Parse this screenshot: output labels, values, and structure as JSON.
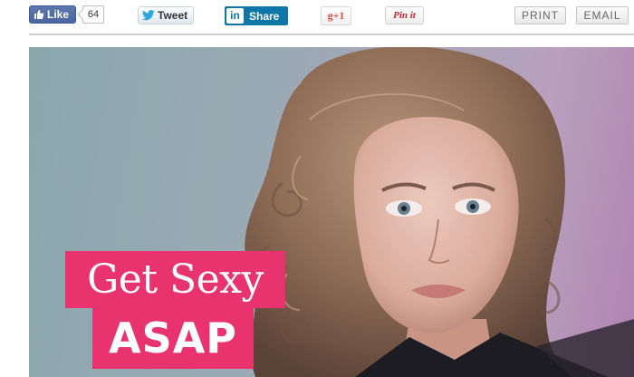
{
  "share_bar": {
    "facebook": {
      "label": "Like",
      "count": "64"
    },
    "twitter": {
      "label": "Tweet"
    },
    "linkedin": {
      "logo": "in",
      "label": "Share"
    },
    "google_plus": {
      "label": "g+1"
    },
    "pinterest": {
      "label": "Pin it"
    },
    "print": {
      "label": "PRINT"
    },
    "email": {
      "label": "EMAIL"
    }
  },
  "hero": {
    "headline_line1": "Get Sexy",
    "headline_line2": "ASAP",
    "accent_color": "#e8336f"
  },
  "colors": {
    "facebook_blue": "#3b5998",
    "linkedin_blue": "#0e76a8",
    "google_red": "#dd4b39",
    "pinterest_red": "#cb2027"
  }
}
